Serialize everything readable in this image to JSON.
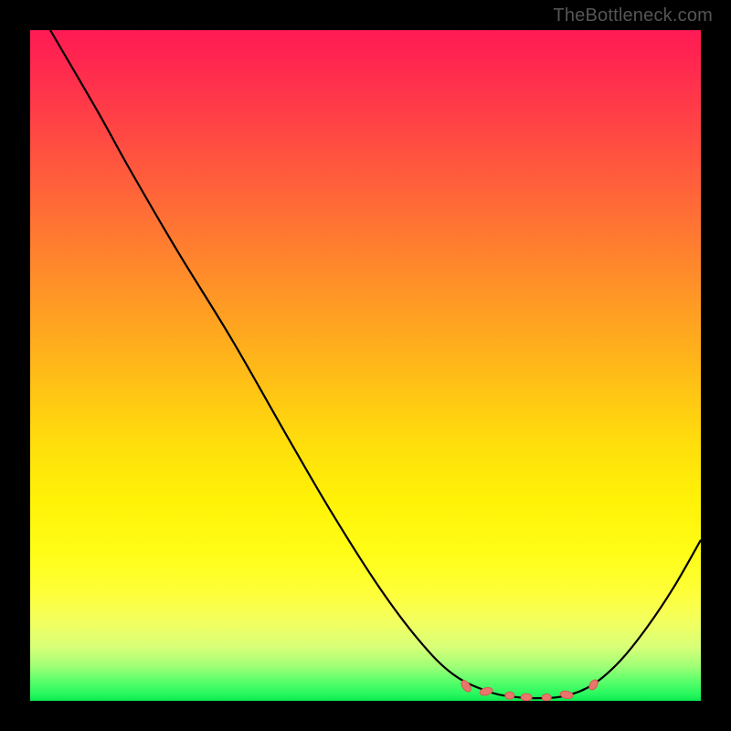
{
  "watermark": "TheBottleneck.com",
  "chart_data": {
    "type": "line",
    "title": "",
    "xlabel": "",
    "ylabel": "",
    "x_range": [
      0,
      100
    ],
    "y_range": [
      0,
      100
    ],
    "series": [
      {
        "name": "curve",
        "points": [
          {
            "x": 3,
            "y": 100
          },
          {
            "x": 10,
            "y": 88
          },
          {
            "x": 15,
            "y": 79
          },
          {
            "x": 22,
            "y": 67
          },
          {
            "x": 30,
            "y": 54
          },
          {
            "x": 38,
            "y": 40
          },
          {
            "x": 45,
            "y": 28
          },
          {
            "x": 52,
            "y": 17
          },
          {
            "x": 58,
            "y": 9
          },
          {
            "x": 63,
            "y": 4
          },
          {
            "x": 68,
            "y": 1.5
          },
          {
            "x": 72,
            "y": 0.6
          },
          {
            "x": 76,
            "y": 0.4
          },
          {
            "x": 80,
            "y": 0.8
          },
          {
            "x": 84,
            "y": 2.5
          },
          {
            "x": 88,
            "y": 6
          },
          {
            "x": 92,
            "y": 11
          },
          {
            "x": 96,
            "y": 17
          },
          {
            "x": 100,
            "y": 24
          }
        ]
      }
    ],
    "markers": [
      {
        "x": 65,
        "y": 2.2,
        "rx": 4,
        "ry": 7,
        "rot": -35
      },
      {
        "x": 68,
        "y": 1.4,
        "rx": 7,
        "ry": 4,
        "rot": -15
      },
      {
        "x": 71.5,
        "y": 0.8,
        "rx": 5,
        "ry": 4,
        "rot": 0
      },
      {
        "x": 74,
        "y": 0.55,
        "rx": 6,
        "ry": 4,
        "rot": 0
      },
      {
        "x": 77,
        "y": 0.5,
        "rx": 5,
        "ry": 4,
        "rot": 0
      },
      {
        "x": 80,
        "y": 0.9,
        "rx": 7,
        "ry": 4,
        "rot": 10
      },
      {
        "x": 84,
        "y": 2.4,
        "rx": 4,
        "ry": 6,
        "rot": 35
      }
    ],
    "gradient_colors": {
      "top": "#ff1a54",
      "mid": "#ffc514",
      "bottom": "#0ce850"
    }
  }
}
